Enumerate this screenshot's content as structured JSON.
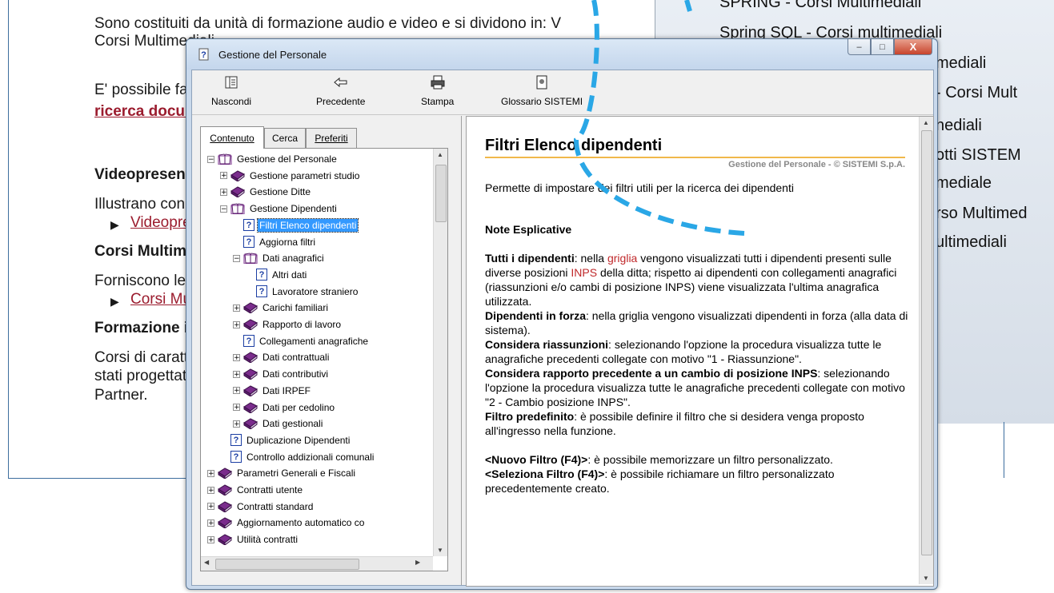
{
  "background": {
    "para1_line1": "Sono costituiti da unità di formazione audio e video e si dividono in: V",
    "para1_line2": "Corsi Multimediali.",
    "para2_line1": "E' possibile fare una",
    "para2_link": "ricerca document",
    "h_video": "Videopresentazio",
    "video_text": "Illustrano con detta",
    "video_link": "Videopresenta",
    "h_corsi": "Corsi Multimedial",
    "corsi_text": "Forniscono le cono",
    "corsi_link": "Corsi Multime",
    "h_form": "Formazione in Au",
    "form_l1": "Corsi di carattere c",
    "form_l2": "stati progettati e rea",
    "form_l3": "Partner.",
    "right_items": [
      "SPRING - Corsi Multimediali",
      "Spring SQL - Corsi multimediali",
      "mediali",
      "- Corsi Mult",
      "nediali",
      "otti SISTEM",
      "mediale",
      "rso Multimed",
      "ultimediali"
    ]
  },
  "window": {
    "title": "Gestione del Personale",
    "controls": {
      "min": "–",
      "max": "□",
      "close": "X"
    }
  },
  "toolbar": {
    "nascondi": "Nascondi",
    "precedente": "Precedente",
    "stampa": "Stampa",
    "glossario": "Glossario SISTEMI"
  },
  "tabs": {
    "contenuto": "Contenuto",
    "cerca": "Cerca",
    "preferiti": "Preferiti"
  },
  "tree": [
    "Gestione del Personale",
    "Gestione parametri studio",
    "Gestione Ditte",
    "Gestione Dipendenti",
    "Filtri Elenco dipendenti",
    "Aggiorna filtri",
    "Dati anagrafici",
    "Altri dati",
    "Lavoratore straniero",
    "Carichi familiari",
    "Rapporto di lavoro",
    "Collegamenti anagrafiche",
    "Dati contrattuali",
    "Dati contributivi",
    "Dati IRPEF",
    "Dati per cedolino",
    "Dati gestionali",
    "Duplicazione Dipendenti",
    "Controllo addizionali comunali",
    "Parametri Generali e Fiscali",
    "Contratti utente",
    "Contratti standard",
    "Aggiornamento automatico co",
    "Utilità contratti"
  ],
  "doc": {
    "title": "Filtri Elenco dipendenti",
    "copyright": "Gestione del Personale - © SISTEMI S.p.A.",
    "intro": "Permette di impostare dei filtri utili per la ricerca dei dipendenti",
    "note_heading": "Note Esplicative",
    "p1_b": "Tutti i dipendenti",
    "p1_a": ": nella ",
    "p1_red1": "griglia",
    "p1_c": " vengono visualizzati tutti i dipendenti presenti sulle diverse posizioni ",
    "p1_red2": "INPS",
    "p1_d": " della ditta; rispetto ai dipendenti con collegamenti anagrafici (riassunzioni e/o cambi di posizione INPS) viene visualizzata l'ultima anagrafica utilizzata.",
    "p2_b": "Dipendenti in forza",
    "p2_t": ": nella griglia vengono visualizzati dipendenti in forza (alla data di sistema).",
    "p3_b": "Considera riassunzioni",
    "p3_t": ": selezionando l'opzione la procedura visualizza tutte le anagrafiche precedenti collegate con motivo \"1 - Riassunzione\".",
    "p4_b": "Considera rapporto precedente a un cambio di posizione INPS",
    "p4_t": ": selezionando l'opzione la procedura visualizza tutte le anagrafiche precedenti collegate con motivo \"2 - Cambio posizione INPS\".",
    "p5_b": "Filtro predefinito",
    "p5_t": ": è possibile definire il filtro che si desidera venga proposto all'ingresso nella funzione.",
    "p6_b": "<Nuovo Filtro (F4)>",
    "p6_t": ": è possibile memorizzare un filtro personalizzato.",
    "p7_b": "<Seleziona Filtro (F4)>",
    "p7_t": ": è possibile richiamare un filtro personalizzato precedentemente creato."
  },
  "colors": {
    "accent_dash": "#2aa7e6",
    "selection": "#3399ff",
    "link_red": "#c0282a",
    "rule": "#f0b84b"
  }
}
